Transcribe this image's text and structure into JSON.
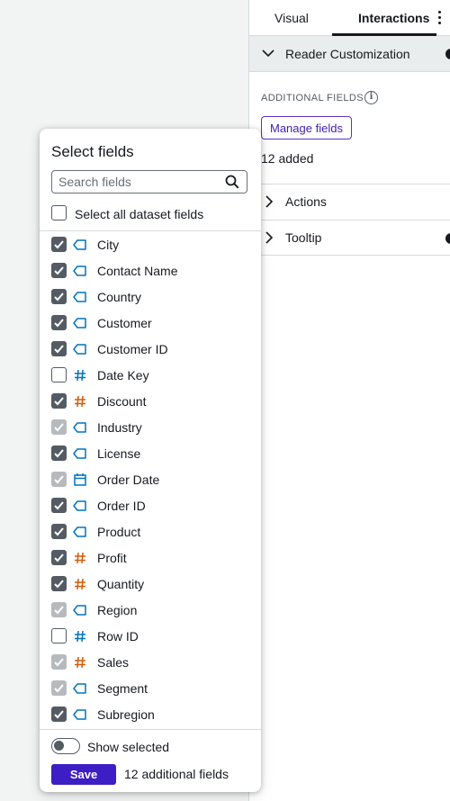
{
  "tabs": [
    {
      "label": "Visual",
      "active": false
    },
    {
      "label": "Interactions",
      "active": true
    }
  ],
  "panel": {
    "section_title": "Reader Customization",
    "additional_fields_label": "ADDITIONAL FIELDS",
    "manage_fields_label": "Manage fields",
    "added_count_text": "12 added",
    "accordions": [
      {
        "label": "Actions",
        "expanded": false
      },
      {
        "label": "Tooltip",
        "expanded": false
      }
    ]
  },
  "popover": {
    "title": "Select fields",
    "search_placeholder": "Search fields",
    "select_all_label": "Select all dataset fields",
    "fields": [
      {
        "name": "City",
        "type": "dimension",
        "state": "checked"
      },
      {
        "name": "Contact Name",
        "type": "dimension",
        "state": "checked"
      },
      {
        "name": "Country",
        "type": "dimension",
        "state": "checked"
      },
      {
        "name": "Customer",
        "type": "dimension",
        "state": "checked"
      },
      {
        "name": "Customer ID",
        "type": "dimension",
        "state": "checked"
      },
      {
        "name": "Date Key",
        "type": "measure-blue",
        "state": "unchecked"
      },
      {
        "name": "Discount",
        "type": "measure",
        "state": "checked"
      },
      {
        "name": "Industry",
        "type": "dimension",
        "state": "disabled"
      },
      {
        "name": "License",
        "type": "dimension",
        "state": "checked"
      },
      {
        "name": "Order Date",
        "type": "date",
        "state": "disabled"
      },
      {
        "name": "Order ID",
        "type": "dimension",
        "state": "checked"
      },
      {
        "name": "Product",
        "type": "dimension",
        "state": "checked"
      },
      {
        "name": "Profit",
        "type": "measure",
        "state": "checked"
      },
      {
        "name": "Quantity",
        "type": "measure",
        "state": "checked"
      },
      {
        "name": "Region",
        "type": "dimension",
        "state": "disabled"
      },
      {
        "name": "Row ID",
        "type": "measure-blue",
        "state": "unchecked"
      },
      {
        "name": "Sales",
        "type": "measure",
        "state": "disabled"
      },
      {
        "name": "Segment",
        "type": "dimension",
        "state": "disabled"
      },
      {
        "name": "Subregion",
        "type": "dimension",
        "state": "checked"
      }
    ],
    "show_selected_label": "Show selected",
    "show_selected_on": false,
    "save_label": "Save",
    "additional_fields_text": "12 additional fields"
  },
  "colors": {
    "dimension_icon": "#0073bb",
    "measure_icon": "#d45b07",
    "primary_button": "#3d1ec4",
    "checkbox_checked": "#545b64",
    "checkbox_disabled": "#b6babd"
  }
}
